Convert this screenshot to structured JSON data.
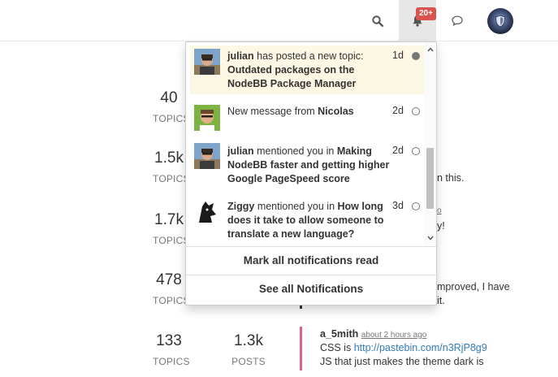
{
  "navbar": {
    "search_icon": "search-icon",
    "bell_icon": "bell-icon",
    "notifications_badge": "20+",
    "chat_icon": "chat-bubble-icon",
    "avatar": "user-avatar"
  },
  "categories": [
    {
      "topics": "40",
      "topics_label": "TOPICS"
    },
    {
      "topics": "1.5k",
      "topics_label": "TOPICS"
    },
    {
      "topics": "1.7k",
      "topics_label": "TOPICS"
    },
    {
      "topics": "478",
      "topics_label": "TOPICS"
    },
    {
      "topics": "133",
      "topics_label": "TOPICS",
      "posts": "1.3k",
      "posts_label": "POSTS"
    }
  ],
  "background_fragments": {
    "row2_text": "n this.",
    "row3_link": "o",
    "row3_text": "y!",
    "row4_text1": "mproved, I have",
    "row4_text2": "it.",
    "row5_user": "a_5mith",
    "row5_time": "about 2 hours ago",
    "row5_line1_prefix": "CSS is",
    "row5_line1_link": "http://pastebin.com/n3RjP8g9",
    "row5_line2": "JS that just makes the theme dark is"
  },
  "notifications": [
    {
      "avatar": "julian-avatar",
      "user": "julian",
      "action": " has posted a new topic: ",
      "target": "Outdated packages on the NodeBB Package Manager",
      "time": "1d",
      "read": false
    },
    {
      "avatar": "nicolas-avatar",
      "user": "",
      "action": "New message from ",
      "target": "Nicolas",
      "time": "2d",
      "read": true
    },
    {
      "avatar": "julian-avatar",
      "user": "julian",
      "action": " mentioned you in ",
      "target": "Making NodeBB faster and getting higher Google PageSpeed score",
      "time": "2d",
      "read": true
    },
    {
      "avatar": "ziggy-avatar",
      "user": "Ziggy",
      "action": " mentioned you in ",
      "target": "How long does it take to allow someone to translate a new language?",
      "time": "3d",
      "read": true
    }
  ],
  "dropdown": {
    "mark_all_read": "Mark all notifications read",
    "see_all": "See all Notifications"
  },
  "colors": {
    "unread_bg": "#fcf8e3",
    "badge": "#d9534f",
    "link": "#337ab7",
    "teaser_bar_row5": "#e06289"
  }
}
